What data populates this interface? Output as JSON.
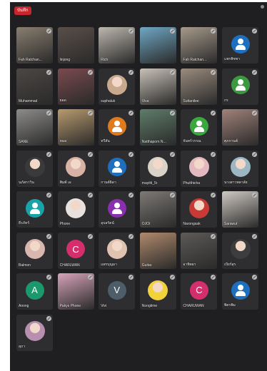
{
  "recording_badge": "บันทึก",
  "tiles": [
    {
      "name": "Fah Ratchan...",
      "kind": "video",
      "bg": "#8a7e70",
      "muted": true
    },
    {
      "name": "linjong",
      "kind": "video",
      "bg": "#5a4f49",
      "muted": false
    },
    {
      "name": "Rich",
      "kind": "video",
      "bg": "#bdb7ae",
      "muted": true
    },
    {
      "name": "",
      "kind": "video",
      "bg": "#6fa7c4",
      "muted": true
    },
    {
      "name": "Fah Ratchan...",
      "kind": "video",
      "bg": "#a79a8b",
      "muted": true
    },
    {
      "name": "แพรพิชชา",
      "kind": "avatar",
      "bg": "#1f6fbf",
      "muted": true
    },
    {
      "name": "Muhammad",
      "kind": "video",
      "bg": "#4c4744",
      "muted": true
    },
    {
      "name": "ยอด",
      "kind": "video",
      "bg": "#7a4a4e",
      "muted": true
    },
    {
      "name": "suphaluk",
      "kind": "photo",
      "bg": "#c9a98d",
      "muted": true
    },
    {
      "name": "Viva",
      "kind": "video",
      "bg": "#c8c1b8",
      "muted": true
    },
    {
      "name": "Suttanilee",
      "kind": "video",
      "bg": "#9a8b7e",
      "muted": true
    },
    {
      "name": "กร",
      "kind": "avatar",
      "bg": "#3b9a3f",
      "muted": true
    },
    {
      "name": "SANE",
      "kind": "video",
      "bg": "#8d8c89",
      "muted": true
    },
    {
      "name": "หมอ",
      "kind": "video",
      "bg": "#b89a6e",
      "muted": true
    },
    {
      "name": "ทวีสัน",
      "kind": "avatar",
      "bg": "#e07a1e",
      "muted": true
    },
    {
      "name": "Natthaporn N...",
      "kind": "video",
      "bg": "#5f7d6a",
      "muted": true
    },
    {
      "name": "จันทร์วรรณ",
      "kind": "avatar",
      "bg": "#3aa83e",
      "muted": true
    },
    {
      "name": "ศุภกานต์",
      "kind": "video",
      "bg": "#a1827a",
      "muted": true
    },
    {
      "name": "นภัสกาวิน",
      "kind": "photo",
      "bg": "#3a3a3a",
      "muted": true
    },
    {
      "name": "พิมพ์ เอ",
      "kind": "photo",
      "bg": "#d8b2a6",
      "muted": true
    },
    {
      "name": "กานต์ธิดา",
      "kind": "avatar",
      "bg": "#1f6fbf",
      "muted": true
    },
    {
      "name": "mayitti_5r",
      "kind": "photo",
      "bg": "#d9d2c6",
      "muted": true
    },
    {
      "name": "Phutthicha",
      "kind": "photo",
      "bg": "#e3b9c0",
      "muted": true
    },
    {
      "name": "นางสาวพลาลัย",
      "kind": "photo",
      "bg": "#9bb7c3",
      "muted": true
    },
    {
      "name": "ธีรภัทร์",
      "kind": "avatar",
      "bg": "#19a3a8",
      "muted": true
    },
    {
      "name": "Phone",
      "kind": "photo",
      "bg": "#e9e1dd",
      "muted": true
    },
    {
      "name": "อุบลรัตน์",
      "kind": "avatar",
      "bg": "#8a2fb0",
      "muted": true
    },
    {
      "name": "OJOI",
      "kind": "video",
      "bg": "#7e7a76",
      "muted": true
    },
    {
      "name": "Narongsak",
      "kind": "photo",
      "bg": "#c83a35",
      "muted": true
    },
    {
      "name": "Sarawut",
      "kind": "video",
      "bg": "#cfc9c3",
      "muted": true
    },
    {
      "name": "Balmon",
      "kind": "photo",
      "bg": "#d9b7b0",
      "muted": true
    },
    {
      "name": "CHARLWAN",
      "kind": "avatar",
      "letter": "C",
      "bg": "#d52e6c",
      "muted": true
    },
    {
      "name": "แพรบุญมา",
      "kind": "photo",
      "bg": "#e0c2b1",
      "muted": true
    },
    {
      "name": "Guitar",
      "kind": "video",
      "bg": "#b08a6c",
      "muted": false
    },
    {
      "name": "อาทิตยา",
      "kind": "video",
      "bg": "#5d5a57",
      "muted": true
    },
    {
      "name": "เบียร์สุร",
      "kind": "photo",
      "bg": "#3d3d3d",
      "muted": true
    },
    {
      "name": "Anong",
      "kind": "avatar",
      "letter": "A",
      "bg": "#1a9a6c",
      "muted": true
    },
    {
      "name": "Pakys Phone",
      "kind": "video",
      "bg": "#d6a3b8",
      "muted": true
    },
    {
      "name": "Vivi",
      "kind": "avatar",
      "letter": "V",
      "bg": "#4d5e6a",
      "muted": true
    },
    {
      "name": "Nongtime",
      "kind": "photo",
      "bg": "#f2d23a",
      "muted": true
    },
    {
      "name": "CHARUWAN",
      "kind": "avatar",
      "letter": "C",
      "bg": "#d52e6c",
      "muted": true
    },
    {
      "name": "พิตรพิม",
      "kind": "avatar",
      "bg": "#1f6fbf",
      "muted": true
    },
    {
      "name": "สุภา",
      "kind": "photo",
      "bg": "#b98fb0",
      "muted": true
    }
  ]
}
